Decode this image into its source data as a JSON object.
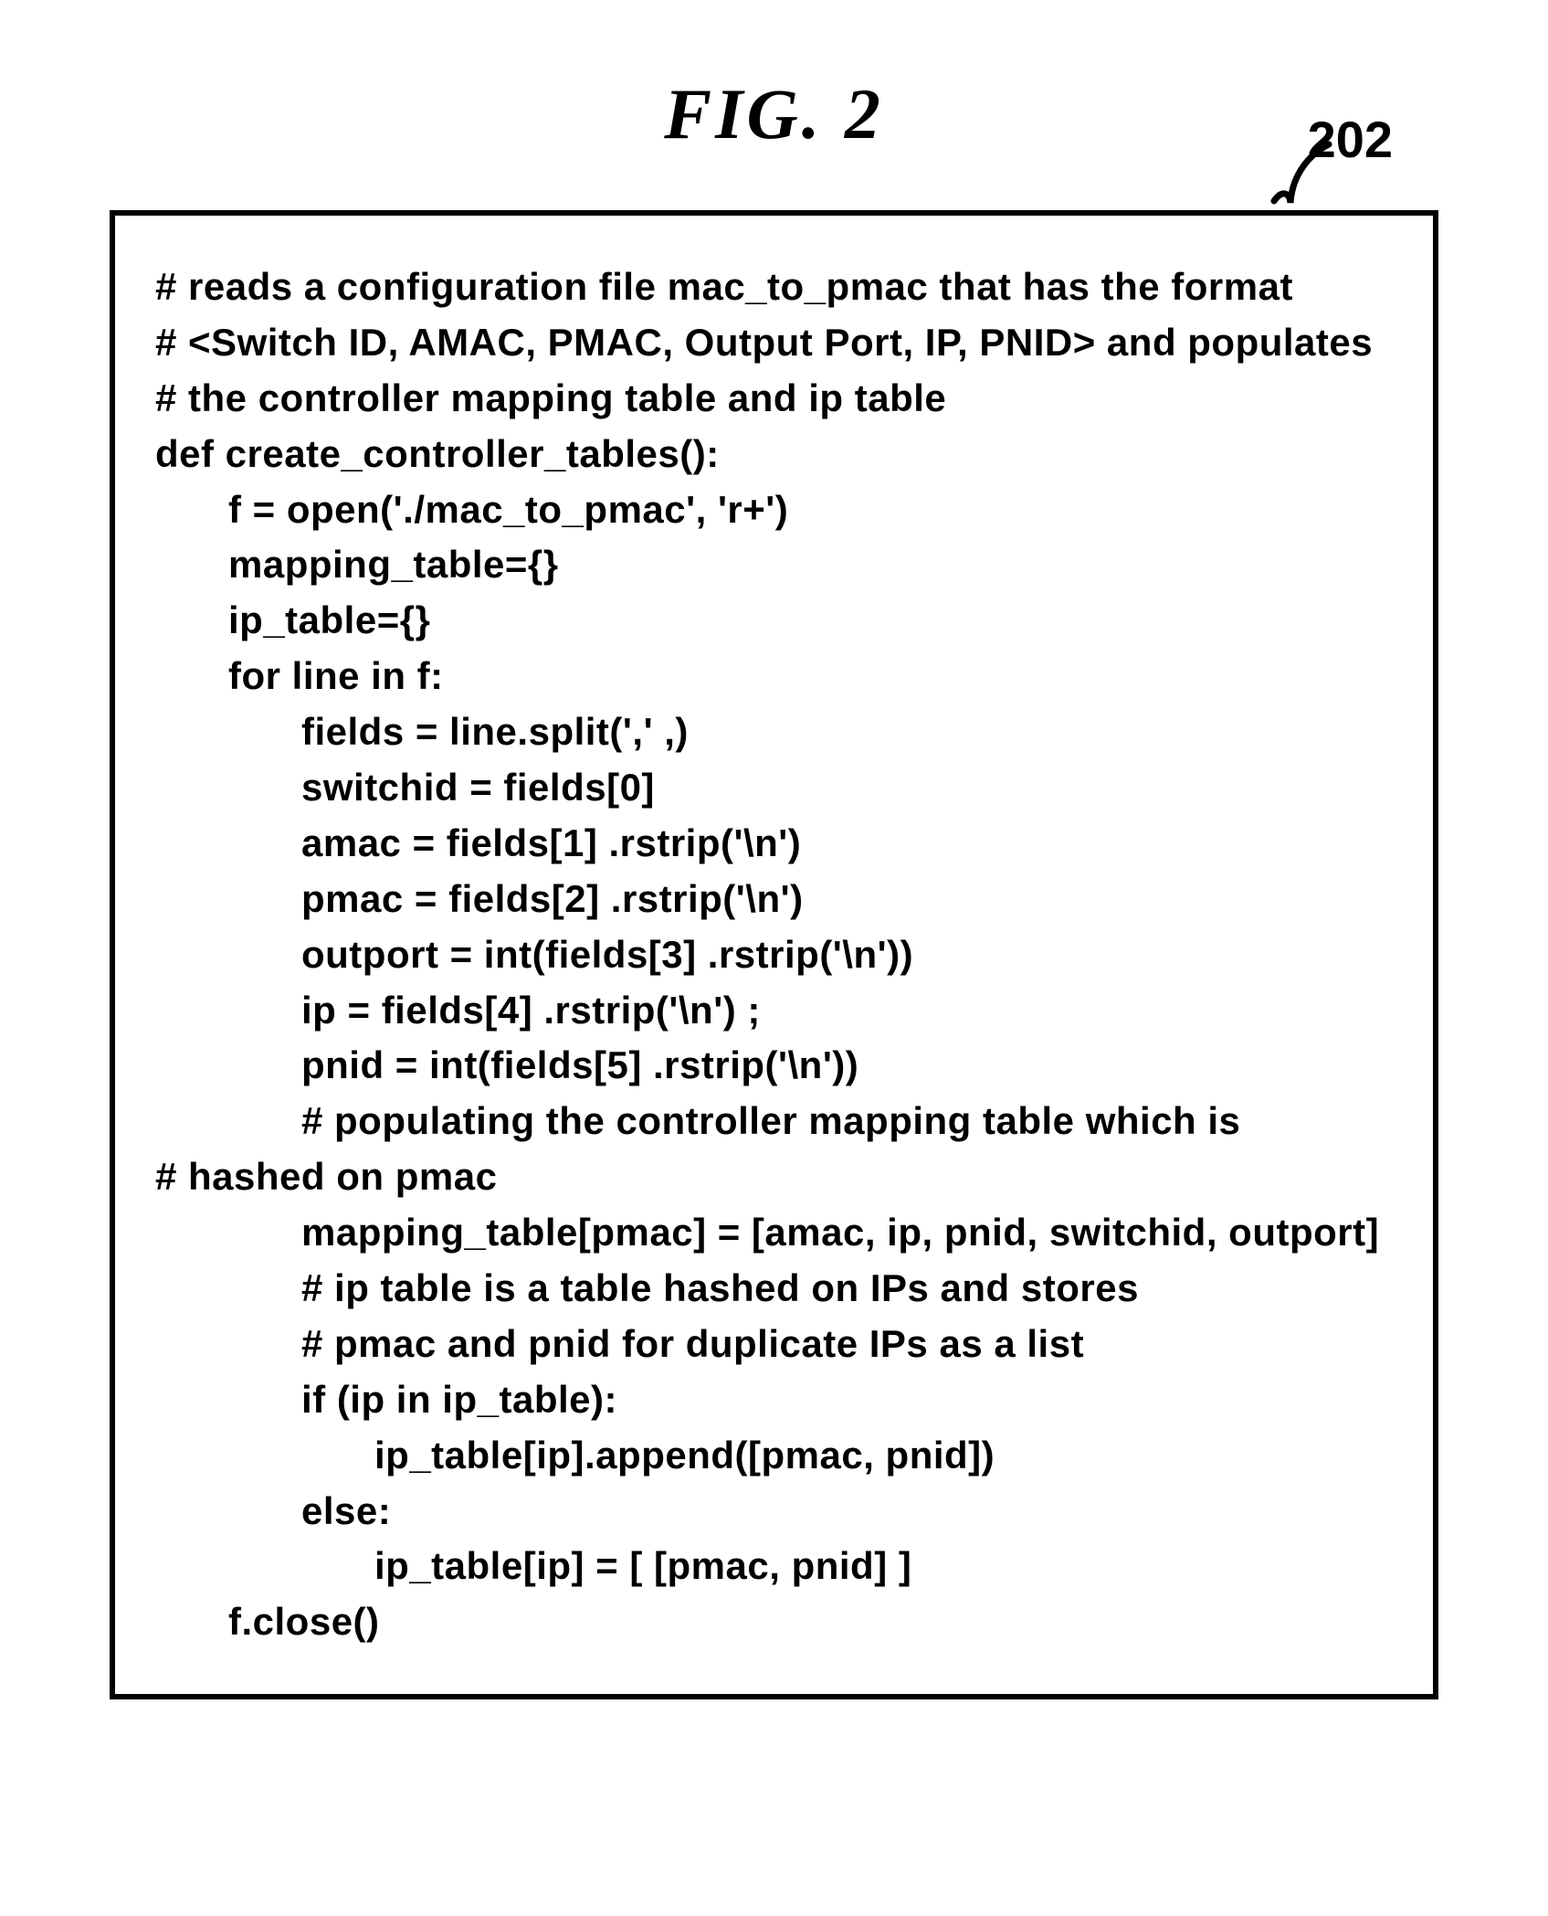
{
  "figure": {
    "title": "FIG.  2",
    "reference_number": "202"
  },
  "code": {
    "lines": [
      {
        "indent": 0,
        "text": "# reads a configuration file mac_to_pmac that has the format"
      },
      {
        "indent": 0,
        "text": "# <Switch ID, AMAC, PMAC, Output Port, IP, PNID> and populates"
      },
      {
        "indent": 0,
        "text": "# the controller mapping table and ip table"
      },
      {
        "indent": 0,
        "text": "def create_controller_tables():"
      },
      {
        "indent": 1,
        "text": "f = open('./mac_to_pmac', 'r+')"
      },
      {
        "indent": 1,
        "text": "mapping_table={}"
      },
      {
        "indent": 1,
        "text": "ip_table={}"
      },
      {
        "indent": 1,
        "text": "for line in f:"
      },
      {
        "indent": 2,
        "text": "fields = line.split(',' ,)"
      },
      {
        "indent": 2,
        "text": "switchid = fields[0]"
      },
      {
        "indent": 2,
        "text": "amac = fields[1] .rstrip('\\n')"
      },
      {
        "indent": 2,
        "text": "pmac = fields[2] .rstrip('\\n')"
      },
      {
        "indent": 2,
        "text": "outport = int(fields[3] .rstrip('\\n'))"
      },
      {
        "indent": 2,
        "text": "ip = fields[4] .rstrip('\\n') ;"
      },
      {
        "indent": 2,
        "text": "pnid = int(fields[5] .rstrip('\\n'))"
      },
      {
        "indent": 2,
        "text": "# populating the controller mapping table which is"
      },
      {
        "indent": 0,
        "text": "# hashed on pmac"
      },
      {
        "indent": 2,
        "text": "mapping_table[pmac] = [amac, ip, pnid, switchid, outport]"
      },
      {
        "indent": 2,
        "text": "# ip table is a table hashed on IPs and stores"
      },
      {
        "indent": 2,
        "text": "# pmac and pnid for duplicate IPs as a list"
      },
      {
        "indent": 2,
        "text": "if (ip in ip_table):"
      },
      {
        "indent": 3,
        "text": "ip_table[ip].append([pmac, pnid])"
      },
      {
        "indent": 2,
        "text": "else:"
      },
      {
        "indent": 3,
        "text": "ip_table[ip] = [ [pmac, pnid] ]"
      },
      {
        "indent": 1,
        "text": "f.close()"
      }
    ]
  }
}
